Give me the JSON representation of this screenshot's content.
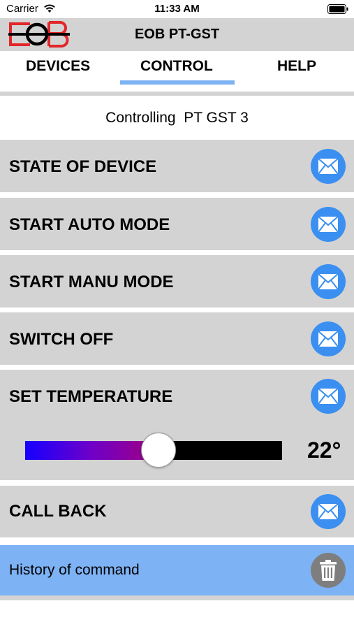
{
  "status_bar": {
    "carrier": "Carrier",
    "time": "11:33 AM"
  },
  "header": {
    "title": "EOB PT-GST",
    "logo_text": "EOB"
  },
  "tabs": [
    {
      "label": "DEVICES",
      "selected": false
    },
    {
      "label": "CONTROL",
      "selected": true
    },
    {
      "label": "HELP",
      "selected": false
    }
  ],
  "controlling": {
    "text": "Controlling  PT GST 3"
  },
  "commands": [
    {
      "label": "STATE OF DEVICE",
      "icon": "mail-icon"
    },
    {
      "label": "START AUTO MODE",
      "icon": "mail-icon"
    },
    {
      "label": "START MANU MODE",
      "icon": "mail-icon"
    },
    {
      "label": "SWITCH OFF",
      "icon": "mail-icon"
    },
    {
      "label": "SET TEMPERATURE",
      "icon": "mail-icon"
    },
    {
      "label": "CALL BACK",
      "icon": "mail-icon"
    }
  ],
  "temperature": {
    "value_label": "22°",
    "slider_fraction": 0.52
  },
  "history": {
    "label": "History of command",
    "icon": "trash-icon"
  },
  "colors": {
    "accent": "#7db2f4",
    "button_blue": "#3a8ff0",
    "row_gray": "#d3d3d3",
    "logo_red": "#e3262a"
  }
}
